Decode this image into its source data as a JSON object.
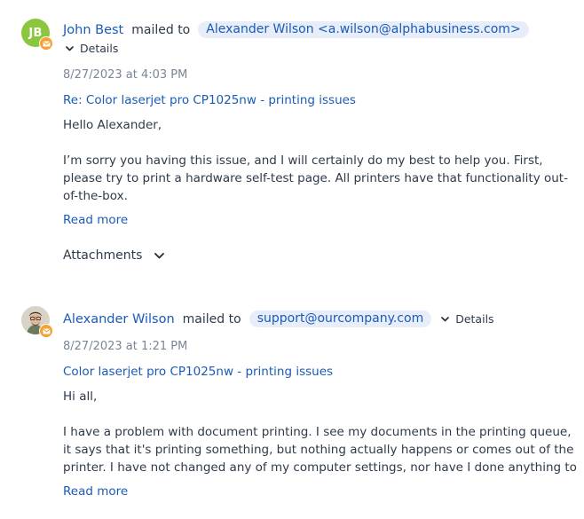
{
  "messages": [
    {
      "avatar_initials": "JB",
      "sender": "John Best",
      "mailed_to_label": "mailed to",
      "recipient": "Alexander Wilson <a.wilson@alphabusiness.com>",
      "details_label": "Details",
      "date": "8/27/2023 at 4:03 PM",
      "subject": "Re: Color laserjet pro CP1025nw - printing issues",
      "greeting": "Hello Alexander,",
      "body_lines": [
        "I’m sorry you having this issue, and I will certainly do my best to help you. First,",
        "please try to print a hardware self-test page. All printers have that functionality out-",
        "of-the-box."
      ],
      "read_more": "Read more",
      "attachments_label": "Attachments"
    },
    {
      "sender": "Alexander Wilson",
      "mailed_to_label": "mailed to",
      "recipient": "support@ourcompany.com",
      "details_label": "Details",
      "date": "8/27/2023 at 1:21 PM",
      "subject": "Color laserjet pro CP1025nw - printing issues",
      "greeting": "Hi all,",
      "body_lines": [
        "I have a problem with document printing. I see my documents in the printing queue,",
        "it says that it's printing something, but nothing actually happens or comes out of the",
        "printer. I have not changed any of my computer settings, nor have I done anything to"
      ],
      "read_more": "Read more"
    }
  ],
  "colors": {
    "link": "#1a5bb8",
    "pill_bg": "#e8eef9",
    "avatar_green": "#8cc63f",
    "mail_badge": "#f4a132",
    "muted": "#7a8696"
  },
  "icons": [
    "mail-icon",
    "chevron-down-icon"
  ]
}
